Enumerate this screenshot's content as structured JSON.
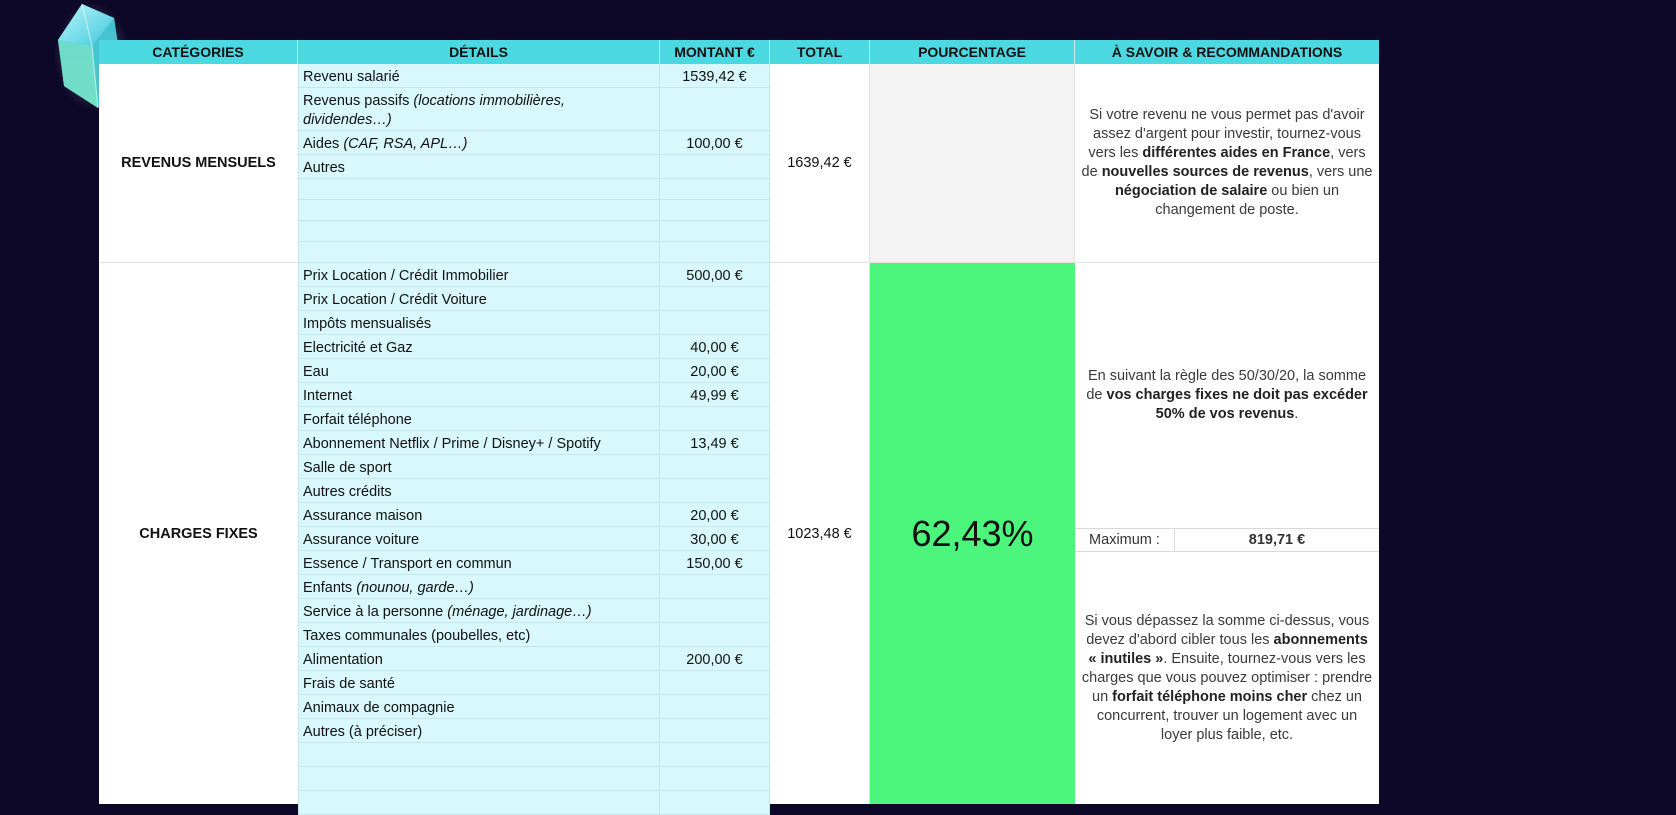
{
  "headers": {
    "categories": "CATÉGORIES",
    "details": "DÉTAILS",
    "amount": "MONTANT €",
    "total": "TOTAL",
    "percentage": "POURCENTAGE",
    "advice": "À SAVOIR & RECOMMANDATIONS"
  },
  "revenus": {
    "category": "REVENUS MENSUELS",
    "total": "1639,42 €",
    "rows": [
      {
        "label": "Revenu salarié",
        "note": "",
        "amount": "1539,42 €"
      },
      {
        "label": "Revenus passifs ",
        "note": "(locations immobilières, dividendes…)",
        "amount": ""
      },
      {
        "label": "Aides ",
        "note": "(CAF, RSA, APL…)",
        "amount": "100,00 €"
      },
      {
        "label": "Autres",
        "note": "",
        "amount": ""
      },
      {
        "label": "",
        "note": "",
        "amount": ""
      },
      {
        "label": "",
        "note": "",
        "amount": ""
      },
      {
        "label": "",
        "note": "",
        "amount": ""
      },
      {
        "label": "",
        "note": "",
        "amount": ""
      }
    ],
    "advice": {
      "p1": "Si votre revenu ne vous permet pas d'avoir assez d'argent pour investir, tournez-vous vers les ",
      "b1": "différentes aides en France",
      "p2": ", vers de ",
      "b2": "nouvelles sources de revenus",
      "p3": ", vers une ",
      "b3": "négociation de salaire",
      "p4": " ou bien un changement de poste."
    }
  },
  "charges": {
    "category": "CHARGES FIXES",
    "total": "1023,48 €",
    "percentage": "62,43%",
    "percentage_color": "#4cf57c",
    "rows": [
      {
        "label": "Prix Location / Crédit Immobilier",
        "note": "",
        "amount": "500,00 €"
      },
      {
        "label": "Prix Location / Crédit Voiture",
        "note": "",
        "amount": ""
      },
      {
        "label": "Impôts mensualisés",
        "note": "",
        "amount": ""
      },
      {
        "label": "Electricité et Gaz",
        "note": "",
        "amount": "40,00 €"
      },
      {
        "label": "Eau",
        "note": "",
        "amount": "20,00 €"
      },
      {
        "label": "Internet",
        "note": "",
        "amount": "49,99 €"
      },
      {
        "label": "Forfait téléphone",
        "note": "",
        "amount": ""
      },
      {
        "label": "Abonnement Netflix / Prime / Disney+ / Spotify",
        "note": "",
        "amount": "13,49 €"
      },
      {
        "label": "Salle de sport",
        "note": "",
        "amount": ""
      },
      {
        "label": "Autres crédits",
        "note": "",
        "amount": ""
      },
      {
        "label": "Assurance maison",
        "note": "",
        "amount": "20,00 €"
      },
      {
        "label": "Assurance voiture",
        "note": "",
        "amount": "30,00 €"
      },
      {
        "label": "Essence / Transport en commun",
        "note": "",
        "amount": "150,00 €"
      },
      {
        "label": "Enfants ",
        "note": "(nounou, garde…)",
        "amount": ""
      },
      {
        "label": "Service à la personne ",
        "note": "(ménage, jardinage…)",
        "amount": ""
      },
      {
        "label": "Taxes communales (poubelles, etc)",
        "note": "",
        "amount": ""
      },
      {
        "label": "Alimentation",
        "note": "",
        "amount": "200,00 €"
      },
      {
        "label": "Frais de santé",
        "note": "",
        "amount": ""
      },
      {
        "label": "Animaux de compagnie",
        "note": "",
        "amount": ""
      },
      {
        "label": "Autres (à préciser)",
        "note": "",
        "amount": ""
      },
      {
        "label": "",
        "note": "",
        "amount": ""
      },
      {
        "label": "",
        "note": "",
        "amount": ""
      },
      {
        "label": "",
        "note": "",
        "amount": ""
      }
    ],
    "advice_top": {
      "p1": "En suivant la règle des 50/30/20, la somme de ",
      "b1": "vos charges fixes ne doit pas excéder 50% de vos revenus",
      "p2": "."
    },
    "max_label": "Maximum :",
    "max_value": "819,71 €",
    "advice_bottom": {
      "p1": "Si vous dépassez la somme ci-dessus, vous devez d'abord cibler tous les ",
      "b1": "abonnements « inutiles »",
      "p2": ". Ensuite, tournez-vous vers les charges que vous pouvez optimiser : prendre un ",
      "b2": "forfait téléphone moins cher",
      "p3": " chez un concurrent, trouver un logement avec un loyer plus faible, etc."
    }
  }
}
